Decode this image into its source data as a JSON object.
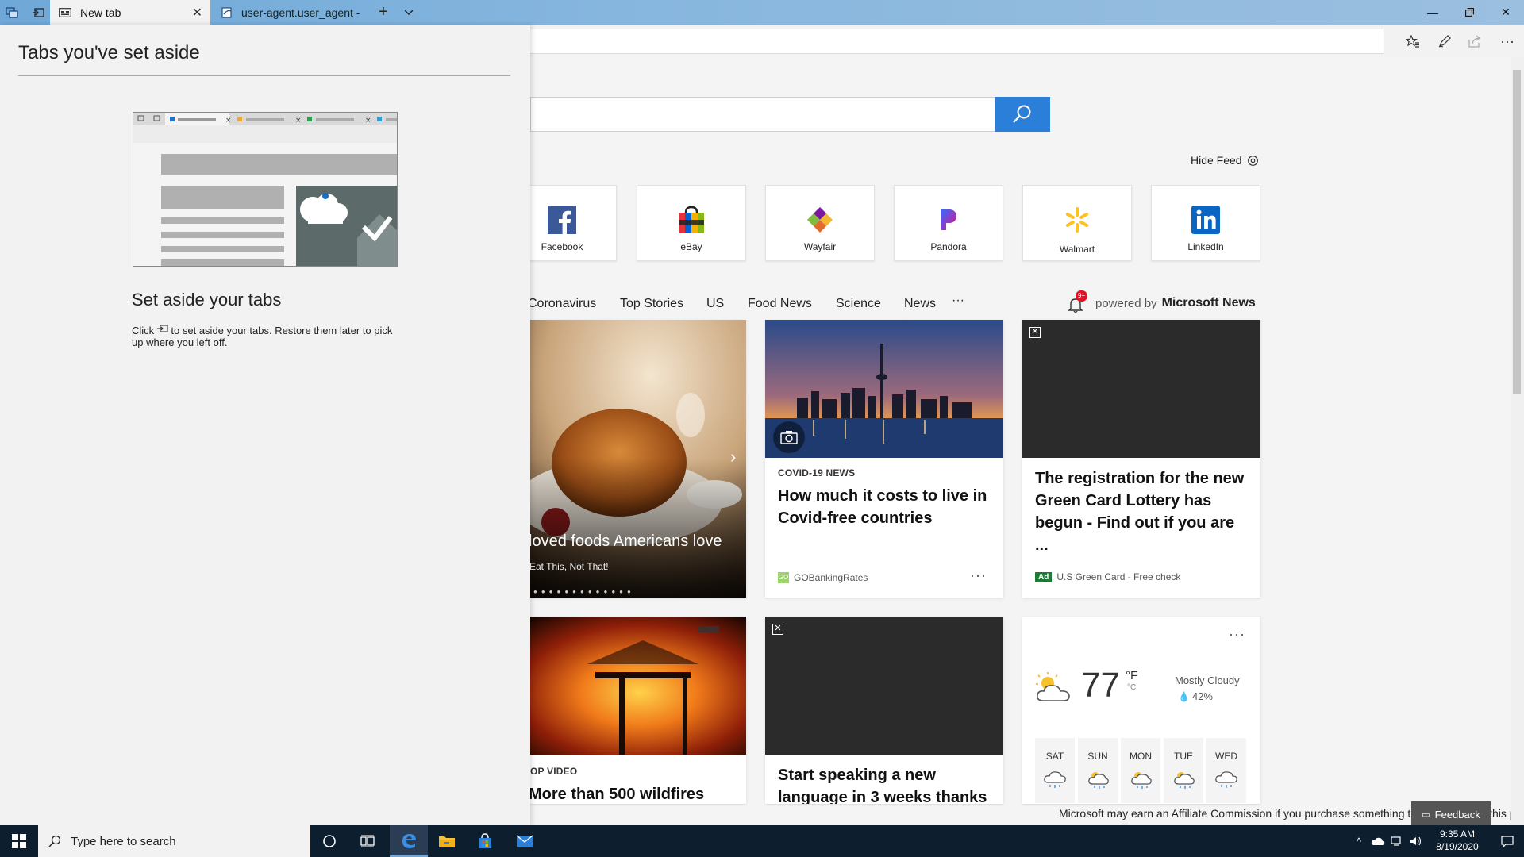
{
  "browser": {
    "tabs": [
      {
        "label": "New tab",
        "active": true
      },
      {
        "label": "user-agent.user_agent - The",
        "active": false
      }
    ],
    "icons": [
      "tabs-aside-icon",
      "set-aside-icon",
      "new-tab-icon",
      "tab-list-chevron-icon",
      "minimize-icon",
      "maximize-icon",
      "close-icon",
      "favorites-icon",
      "pen-icon",
      "share-icon",
      "more-icon"
    ]
  },
  "aside_panel": {
    "title": "Tabs you've set aside",
    "heading": "Set aside your tabs",
    "desc_before": "Click",
    "desc_after": "to set aside your tabs. Restore them later to pick up where you left off."
  },
  "newtab": {
    "hide_feed": "Hide Feed",
    "tiles": [
      {
        "label": "Facebook"
      },
      {
        "label": "eBay"
      },
      {
        "label": "Wayfair"
      },
      {
        "label": "Pandora"
      },
      {
        "label": "Walmart"
      },
      {
        "label": "LinkedIn"
      }
    ],
    "nav": [
      "Coronavirus",
      "Top Stories",
      "US",
      "Food News",
      "Science",
      "News",
      "···"
    ],
    "notification_badge": "9+",
    "powered_by": "powered by",
    "powered_brand": "Microsoft News",
    "cards": {
      "food": {
        "title": "loved foods Americans love",
        "source": "Eat This, Not That!"
      },
      "covid": {
        "category": "COVID-19 NEWS",
        "title": "How much it costs to live in Covid-free countries",
        "source": "GOBankingRates",
        "more": "···"
      },
      "ad": {
        "title": "The registration for the new Green Card Lottery has begun - Find out if you are ...",
        "ad_label": "Ad",
        "source": "U.S Green Card - Free check"
      },
      "fire": {
        "category": "OP VIDEO",
        "title": "More than 500 wildfires"
      },
      "language": {
        "title": "Start speaking a new language in 3 weeks thanks"
      }
    },
    "weather": {
      "temp": "77",
      "unit_f": "°F",
      "unit_c": "°C",
      "condition": "Mostly Cloudy",
      "precip": "42%",
      "more": "···",
      "days": [
        "SAT",
        "SUN",
        "MON",
        "TUE",
        "WED"
      ]
    },
    "affiliate": "Microsoft may earn an Affiliate Commission if you purchase something through links on this page.",
    "feedback": "Feedback"
  },
  "taskbar": {
    "search_placeholder": "Type here to search",
    "time": "9:35 AM",
    "date": "8/19/2020"
  },
  "colors": {
    "accent": "#2b7fd9",
    "taskbar": "#0d1e2e"
  }
}
